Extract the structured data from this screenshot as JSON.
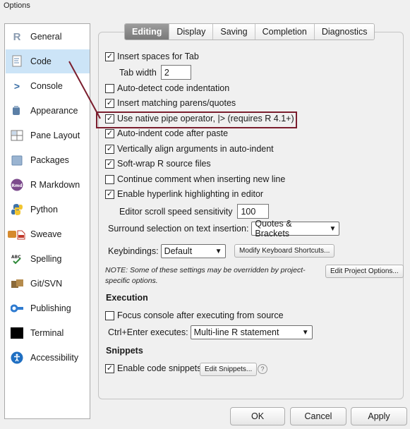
{
  "window": {
    "title": "Options"
  },
  "sidebar": {
    "items": [
      {
        "label": "General",
        "icon": "r-logo-icon"
      },
      {
        "label": "Code",
        "icon": "code-document-icon"
      },
      {
        "label": "Console",
        "icon": "console-prompt-icon"
      },
      {
        "label": "Appearance",
        "icon": "paint-bucket-icon"
      },
      {
        "label": "Pane Layout",
        "icon": "pane-layout-icon"
      },
      {
        "label": "Packages",
        "icon": "package-box-icon"
      },
      {
        "label": "R Markdown",
        "icon": "rmd-icon"
      },
      {
        "label": "Python",
        "icon": "python-logo-icon"
      },
      {
        "label": "Sweave",
        "icon": "sweave-pdf-icon"
      },
      {
        "label": "Spelling",
        "icon": "spellcheck-icon"
      },
      {
        "label": "Git/SVN",
        "icon": "git-svn-icon"
      },
      {
        "label": "Publishing",
        "icon": "publishing-icon"
      },
      {
        "label": "Terminal",
        "icon": "terminal-icon"
      },
      {
        "label": "Accessibility",
        "icon": "accessibility-icon"
      }
    ],
    "active": "Code"
  },
  "tabs": [
    "Editing",
    "Display",
    "Saving",
    "Completion",
    "Diagnostics"
  ],
  "active_tab": "Editing",
  "editing": {
    "insert_spaces": {
      "label": "Insert spaces for Tab",
      "checked": true
    },
    "tab_width": {
      "label": "Tab width",
      "value": "2"
    },
    "auto_detect": {
      "label": "Auto-detect code indentation",
      "checked": false
    },
    "matching_parens": {
      "label": "Insert matching parens/quotes",
      "checked": true
    },
    "native_pipe": {
      "label": "Use native pipe operator, |> (requires R 4.1+)",
      "checked": true
    },
    "auto_indent": {
      "label": "Auto-indent code after paste",
      "checked": true
    },
    "vertical_align": {
      "label": "Vertically align arguments in auto-indent",
      "checked": true
    },
    "soft_wrap": {
      "label": "Soft-wrap R source files",
      "checked": true
    },
    "continue_comment": {
      "label": "Continue comment when inserting new line",
      "checked": false
    },
    "hyperlink": {
      "label": "Enable hyperlink highlighting in editor",
      "checked": true
    },
    "scroll_speed": {
      "label": "Editor scroll speed sensitivity",
      "value": "100"
    },
    "surround": {
      "label": "Surround selection on text insertion:",
      "value": "Quotes & Brackets"
    },
    "keybindings": {
      "label": "Keybindings:",
      "value": "Default"
    },
    "modify_shortcuts_label": "Modify Keyboard Shortcuts...",
    "note": "NOTE: Some of these settings may be overridden by project-specific options.",
    "note_line1": "NOTE: Some of these settings may be overridden by project-",
    "note_line2": "specific options.",
    "edit_project_label": "Edit Project Options..."
  },
  "execution": {
    "heading": "Execution",
    "focus_console": {
      "label": "Focus console after executing from source",
      "checked": false
    },
    "ctrl_enter": {
      "label": "Ctrl+Enter executes:",
      "value": "Multi-line R statement"
    }
  },
  "snippets": {
    "heading": "Snippets",
    "enable": {
      "label": "Enable code snippets",
      "checked": true
    },
    "edit_label": "Edit Snippets...",
    "help": "?"
  },
  "footer": {
    "ok": "OK",
    "cancel": "Cancel",
    "apply": "Apply"
  },
  "colors": {
    "annotation": "#7b1e2e",
    "selected_sidebar": "#cce4f7",
    "active_tab": "#8a8a8a"
  }
}
